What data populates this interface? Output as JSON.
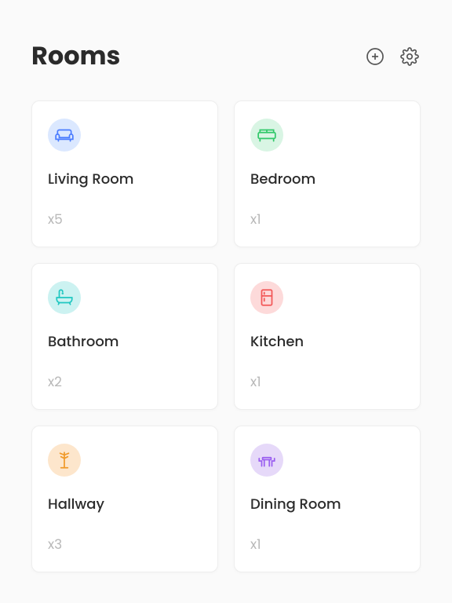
{
  "header": {
    "title": "Rooms"
  },
  "rooms": [
    {
      "name": "Living Room",
      "count": "x5",
      "icon": "sofa-icon",
      "bg": "ic-blue",
      "color": "#4a7cff"
    },
    {
      "name": "Bedroom",
      "count": "x1",
      "icon": "bed-icon",
      "bg": "ic-green",
      "color": "#33c96b"
    },
    {
      "name": "Bathroom",
      "count": "x2",
      "icon": "bathtub-icon",
      "bg": "ic-cyan",
      "color": "#1fc7c1"
    },
    {
      "name": "Kitchen",
      "count": "x1",
      "icon": "fridge-icon",
      "bg": "ic-red",
      "color": "#f25757"
    },
    {
      "name": "Hallway",
      "count": "x3",
      "icon": "coatrack-icon",
      "bg": "ic-orange",
      "color": "#f09a2a"
    },
    {
      "name": "Dining Room",
      "count": "x1",
      "icon": "dining-icon",
      "bg": "ic-purple",
      "color": "#9a5ff0"
    }
  ]
}
